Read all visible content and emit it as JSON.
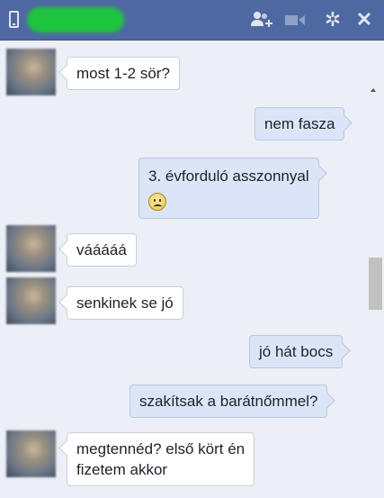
{
  "window": {
    "icons": [
      "phone-icon",
      "add-user-icon",
      "video-icon",
      "gear-icon",
      "close-icon"
    ]
  },
  "messages": [
    {
      "direction": "in",
      "text": "most 1-2 sör?"
    },
    {
      "direction": "out",
      "text": "nem fasza"
    },
    {
      "direction": "out",
      "text": "3. évforduló asszonnyal",
      "emoji": "sad-face-icon"
    },
    {
      "direction": "in",
      "text": "vááááá"
    },
    {
      "direction": "in",
      "text": "senkinek se jó"
    },
    {
      "direction": "out",
      "text": "jó hát bocs"
    },
    {
      "direction": "out",
      "text": "szakítsak a barátnőmmel?"
    },
    {
      "direction": "in",
      "text": "megtennéd? első kört én",
      "text2": "fizetem akkor"
    }
  ],
  "colors": {
    "titlebar": "#4e69a2",
    "background": "#eceff5",
    "outgoing_bubble": "#dbe5f7",
    "incoming_bubble": "#ffffff"
  }
}
